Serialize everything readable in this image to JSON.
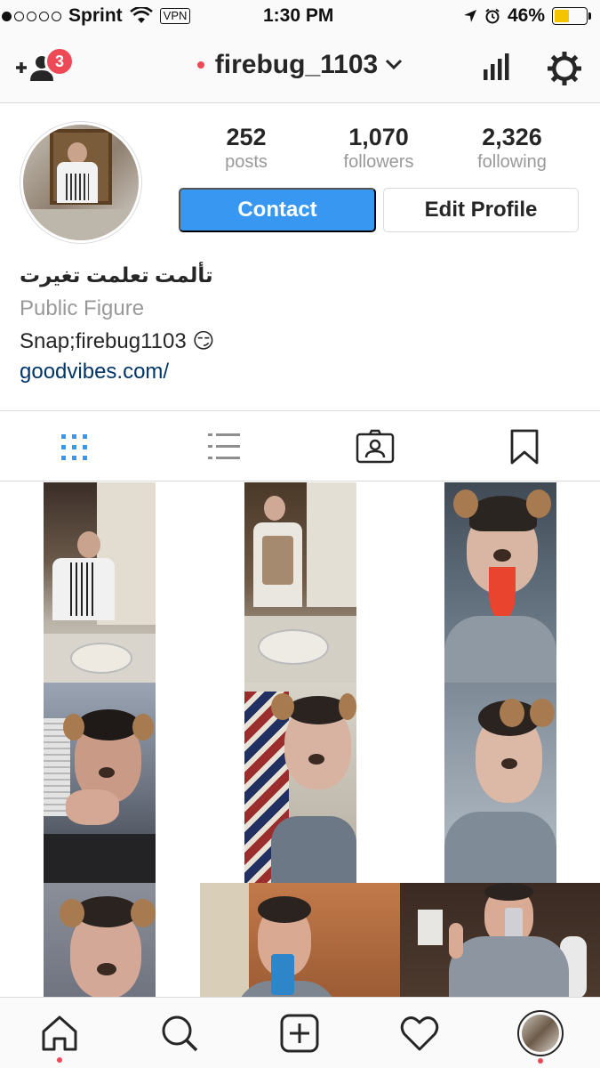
{
  "status_bar": {
    "carrier": "Sprint",
    "vpn": "VPN",
    "time": "1:30 PM",
    "battery": "46%",
    "battery_level": 0.46
  },
  "nav": {
    "notification_count": "3",
    "username": "firebug_1103"
  },
  "profile": {
    "stats": [
      {
        "value": "252",
        "label": "posts"
      },
      {
        "value": "1,070",
        "label": "followers"
      },
      {
        "value": "2,326",
        "label": "following"
      }
    ],
    "contact_label": "Contact",
    "edit_label": "Edit Profile",
    "display_name": "تألمت تعلمت تغيرت",
    "category": "Public Figure",
    "bio": "Snap;firebug1103 😏",
    "link": "goodvibes.com/"
  },
  "tabs": [
    "grid-icon",
    "list-icon",
    "tagged-icon",
    "saved-icon"
  ],
  "colors": {
    "accent": "#3897f0",
    "notification": "#ed4956",
    "link": "#003569",
    "muted": "#999999",
    "battery": "#f5c400"
  },
  "bottom_nav": [
    "home-icon",
    "search-icon",
    "add-post-icon",
    "activity-icon",
    "profile-icon"
  ]
}
